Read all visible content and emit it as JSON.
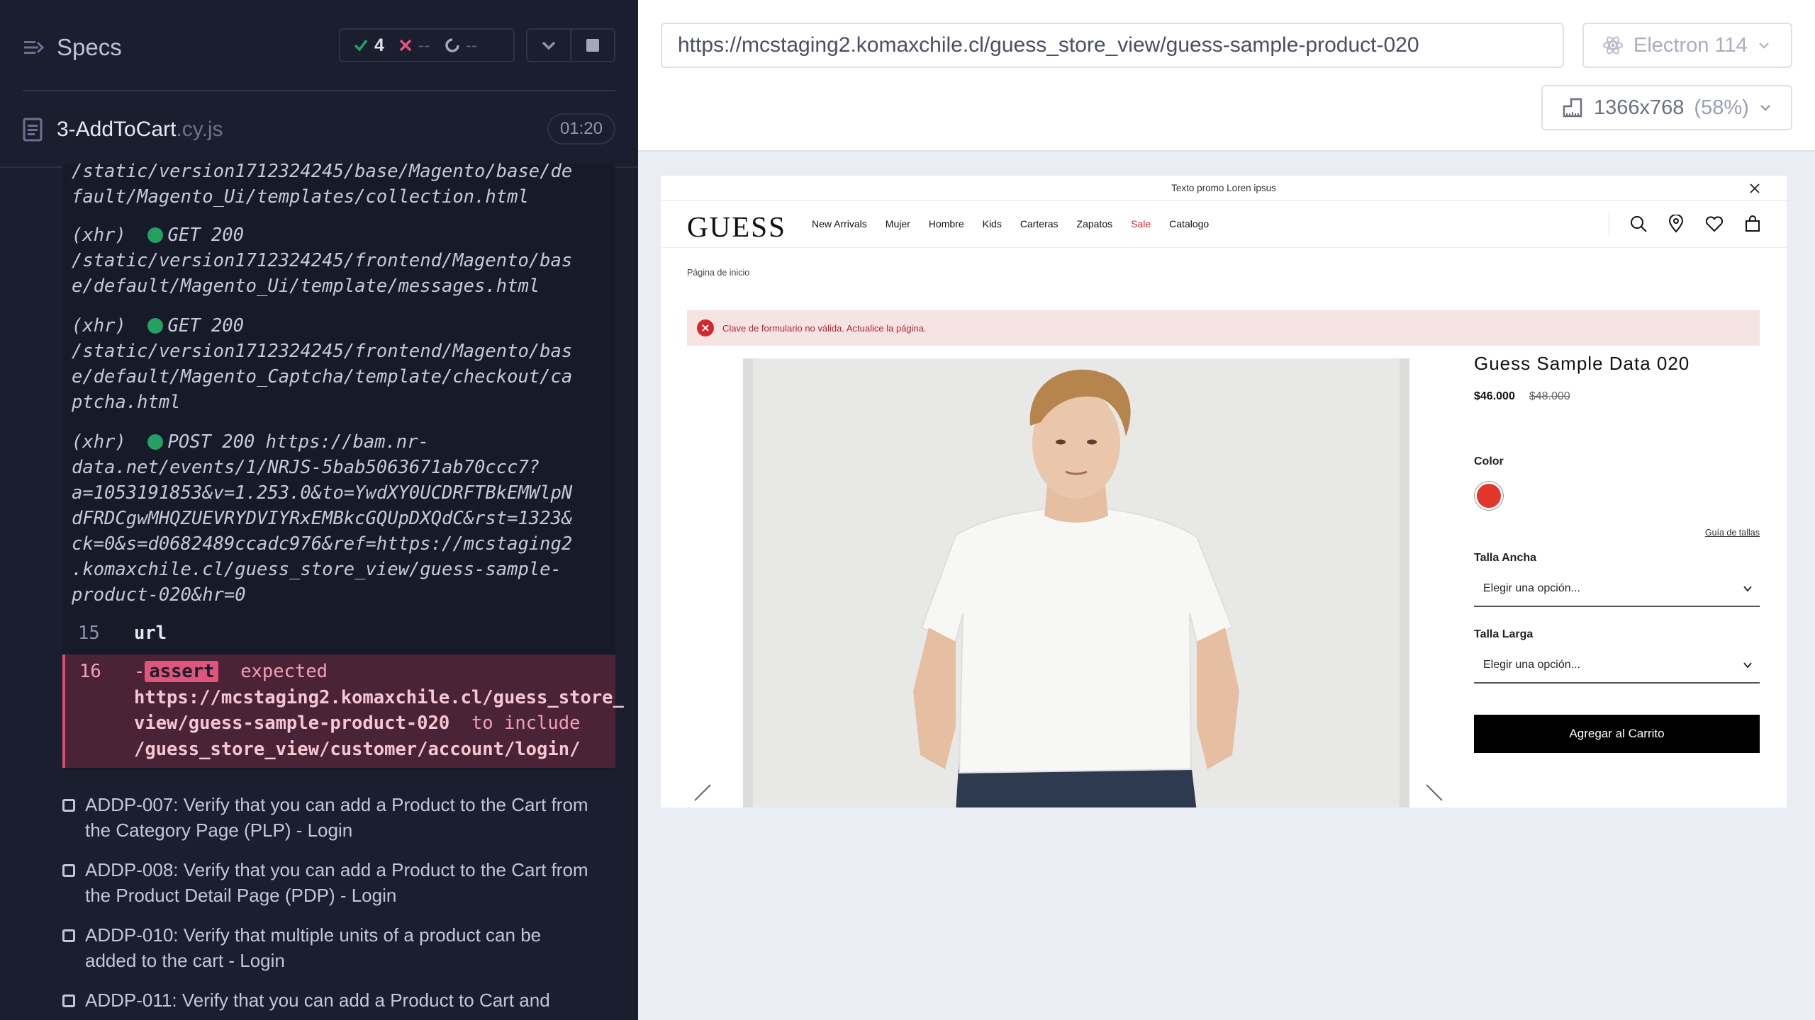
{
  "reporter": {
    "specs_label": "Specs",
    "stats": {
      "passed": "4",
      "failed": "--",
      "pending": "--"
    },
    "spec": {
      "name": "3-AddToCart",
      "ext": ".cy.js",
      "duration": "01:20"
    },
    "log": {
      "xhr_0": "/static/version1712324245/base/Magento/base/default/Magento_Ui/templates/collection.html",
      "xhr_0_line1": "/static/version1712324245/base/Magento/base/de",
      "xhr_0_line2": "fault/Magento_Ui/templates/collection.html",
      "xhr_1_head": "(xhr)",
      "xhr_1_status": "GET 200",
      "xhr_1_line1": "/static/version1712324245/frontend/Magento/bas",
      "xhr_1_line2": "e/default/Magento_Ui/template/messages.html",
      "xhr_2_head": "(xhr)",
      "xhr_2_status": "GET 200",
      "xhr_2_line1": "/static/version1712324245/frontend/Magento/bas",
      "xhr_2_line2": "e/default/Magento_Captcha/template/checkout/ca",
      "xhr_2_line3": "ptcha.html",
      "xhr_3_head": "(xhr)",
      "xhr_3_status": "POST 200 https://bam.nr-",
      "xhr_3_line1": "data.net/events/1/NRJS-5bab5063671ab70ccc7?",
      "xhr_3_line2": "a=1053191853&v=1.253.0&to=YwdXY0UCDRFTBkEMWlpN",
      "xhr_3_line3": "dFRDCgwMHQZUEVRYDVIYRxEMBkcGQUpDXQdC&rst=1323&",
      "xhr_3_line4": "ck=0&s=d0682489ccadc976&ref=https://mcstaging2",
      "xhr_3_line5": ".komaxchile.cl/guess_store_view/guess-sample-",
      "xhr_3_line6": "product-020&hr=0",
      "cmd_15_num": "15",
      "cmd_15_name": "url",
      "cmd_16_num": "16",
      "assert_prefix": "-",
      "assert_label": "assert",
      "assert_expected": "expected",
      "assert_actual_1": "https://mcstaging2.komaxchile.cl/guess_store_",
      "assert_actual_2": "view/guess-sample-product-020",
      "assert_to_include": "to include",
      "assert_target": "/guess_store_view/customer/account/login/"
    },
    "tests": [
      {
        "line1": "ADDP-007: Verify that you can add a Product to the Cart from",
        "line2": "the Category Page (PLP) - Login"
      },
      {
        "line1": "ADDP-008: Verify that you can add a Product to the Cart from",
        "line2": "the Product Detail Page (PDP) - Login"
      },
      {
        "line1": "ADDP-010: Verify that multiple units of a product can be",
        "line2": "added to the cart - Login"
      },
      {
        "line1": "ADDP-011: Verify that you can add a Product to Cart and",
        "line2": ""
      }
    ]
  },
  "aut": {
    "url": "https://mcstaging2.komaxchile.cl/guess_store_view/guess-sample-product-020",
    "browser": "Electron 114",
    "viewport": "1366x768",
    "scale": "(58%)"
  },
  "site": {
    "promo": "Texto promo Loren ipsus",
    "logo": "GUESS",
    "nav": [
      "New Arrivals",
      "Mujer",
      "Hombre",
      "Kids",
      "Carteras",
      "Zapatos",
      "Sale",
      "Catalogo"
    ],
    "breadcrumb": "Página de inicio",
    "alert": "Clave de formulario no válida. Actualice la página.",
    "product": {
      "title": "Guess Sample Data 020",
      "price": "$46.000",
      "old_price": "$48.000",
      "color_label": "Color",
      "swatch_color": "#e2362c",
      "size_guide": "Guía de tallas",
      "talla_ancha_label": "Talla Ancha",
      "talla_ancha_value": "Elegir una opción...",
      "talla_larga_label": "Talla Larga",
      "talla_larga_value": "Elegir una opción...",
      "add_to_cart": "Agregar al Carrito"
    }
  },
  "colors": {
    "reporter_bg": "#1b1e2e",
    "pass_green": "#23a160",
    "fail_red": "#e0557a",
    "sale_red": "#d6262e"
  }
}
